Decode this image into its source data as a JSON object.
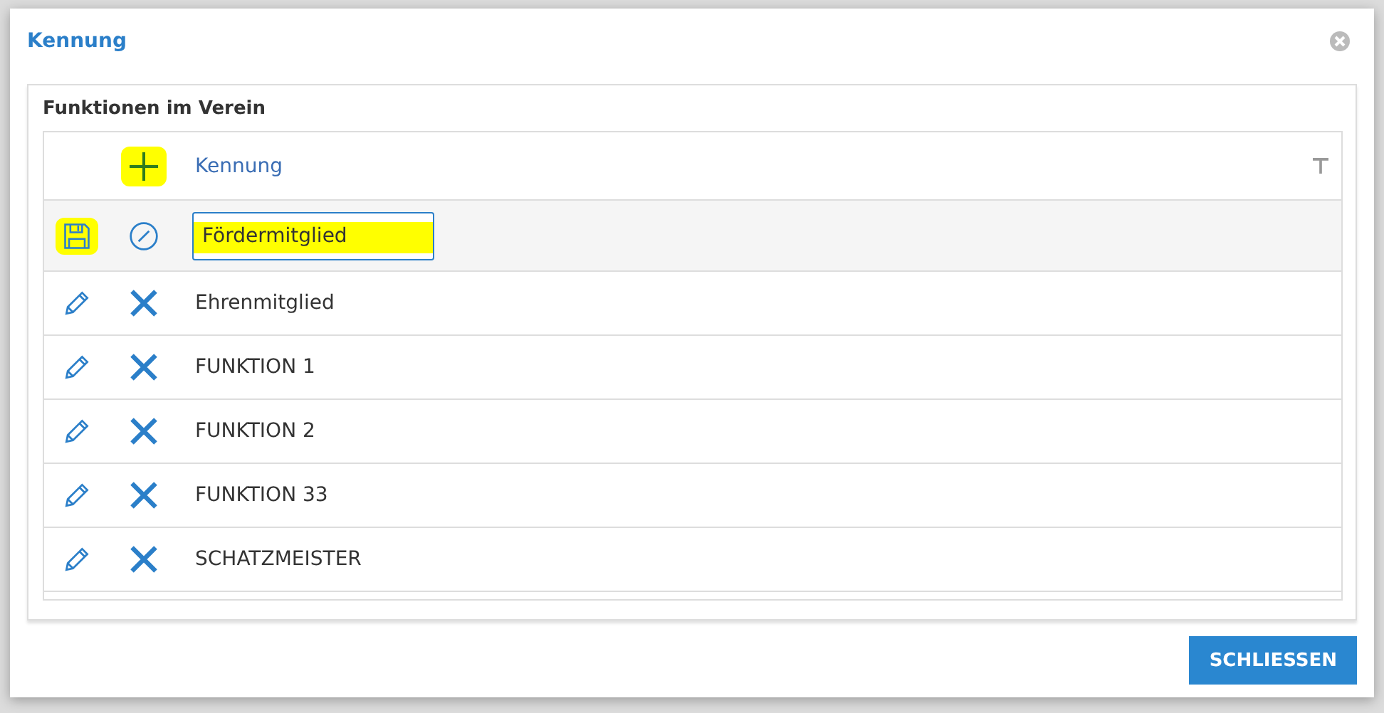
{
  "dialog": {
    "title": "Kennung",
    "panel_title": "Funktionen im Verein"
  },
  "table": {
    "add_highlighted": true,
    "column": "Kennung",
    "rows": [
      {
        "kind": "edit",
        "value": "Fördermitglied",
        "highlighted": true
      },
      {
        "kind": "view",
        "label": "Ehrenmitglied"
      },
      {
        "kind": "view",
        "label": "FUNKTION 1"
      },
      {
        "kind": "view",
        "label": "FUNKTION 2"
      },
      {
        "kind": "view",
        "label": "FUNKTION 33"
      },
      {
        "kind": "view",
        "label": "SCHATZMEISTER"
      }
    ]
  },
  "buttons": [
    "SCHLIESSEN"
  ]
}
